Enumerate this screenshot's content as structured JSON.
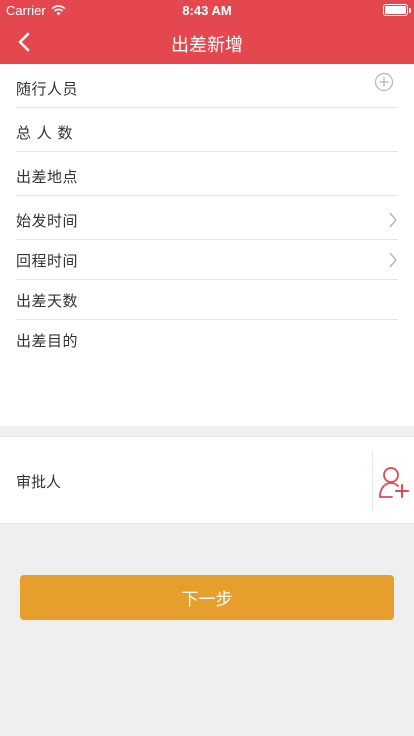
{
  "status_bar": {
    "carrier": "Carrier",
    "time": "8:43 AM"
  },
  "nav": {
    "title": "出差新增",
    "back_icon": "chevron-left-icon"
  },
  "form": {
    "rows": [
      {
        "label": "随行人员",
        "accessory": "plus-circle-icon"
      },
      {
        "label": "总 人 数"
      },
      {
        "label": "出差地点"
      },
      {
        "label": "始发时间",
        "accessory": "chevron-right-icon"
      },
      {
        "label": "回程时间",
        "accessory": "chevron-right-icon"
      },
      {
        "label": "出差天数"
      },
      {
        "label": "出差目的"
      }
    ]
  },
  "approver": {
    "label": "审批人",
    "icon": "add-person-icon",
    "icon_color": "#e5474f"
  },
  "next_button": {
    "label": "下一步",
    "color": "#e69f2d"
  },
  "colors": {
    "header": "#e5474f",
    "background": "#efefef"
  }
}
